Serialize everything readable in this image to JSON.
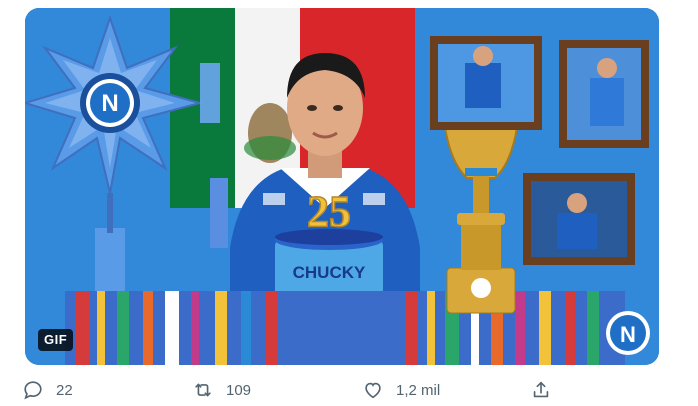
{
  "tweet": {
    "media": {
      "gif_label": "GIF",
      "cake_text": "CHUCKY",
      "candle_number": "25",
      "club_badge_letter": "N"
    },
    "actions": {
      "reply_count": "22",
      "retweet_count": "109",
      "like_count": "1,2 mil"
    }
  },
  "colors": {
    "background_blue": "#2f84d6",
    "napoli_blue": "#1f6fc7",
    "icon_gray": "#536471"
  }
}
